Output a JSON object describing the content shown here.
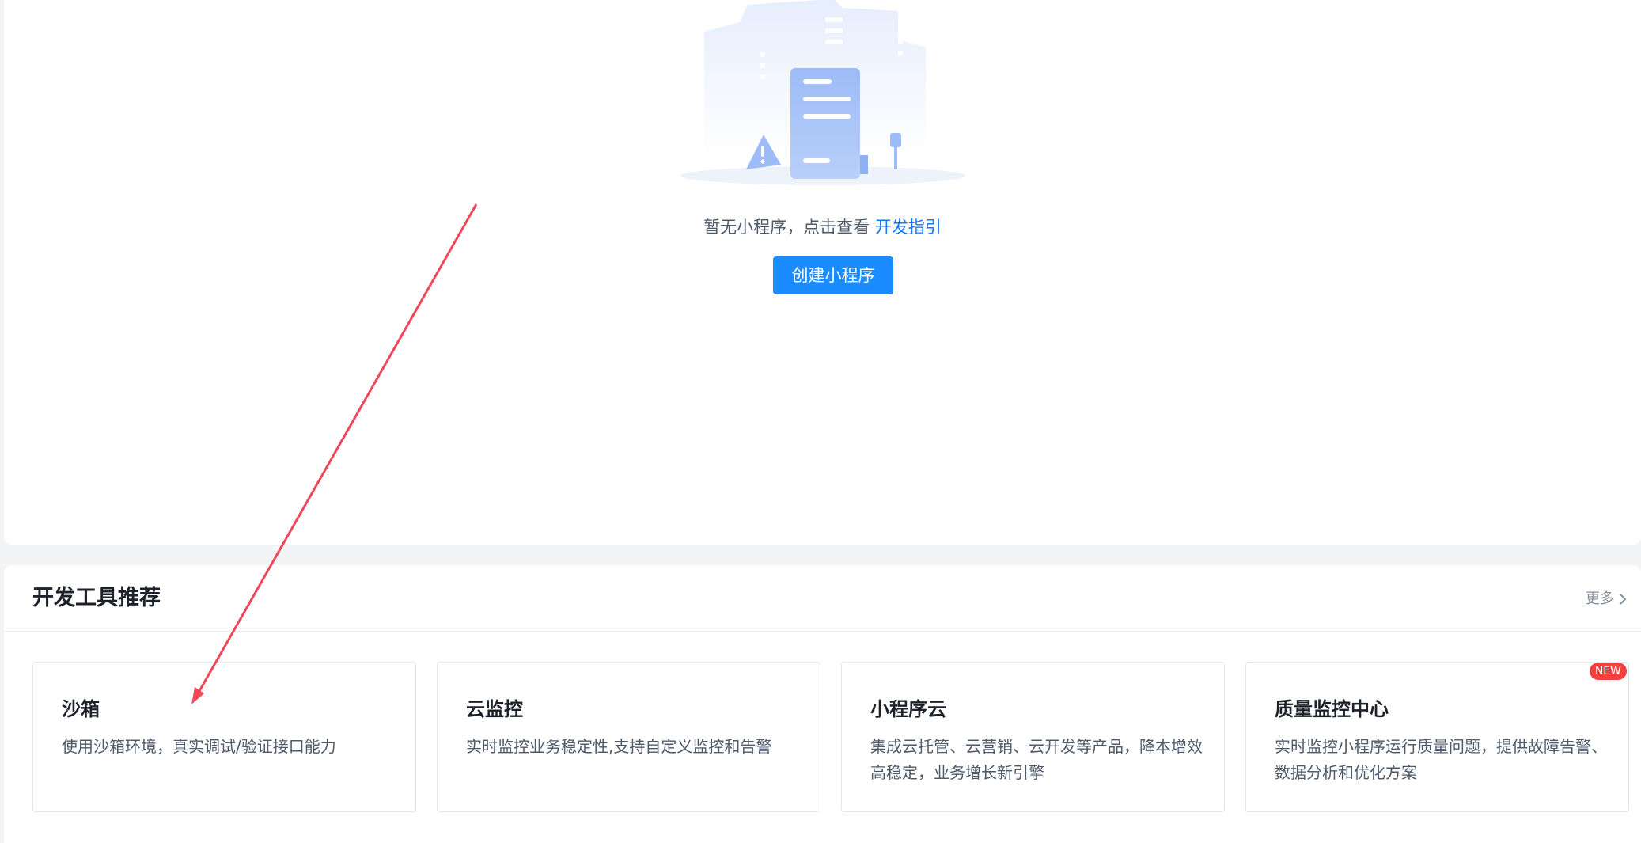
{
  "empty_state": {
    "message": "暂无小程序，点击查看 ",
    "link_label": "开发指引",
    "create_button_label": "创建小程序"
  },
  "tools_section": {
    "title": "开发工具推荐",
    "more_label": "更多",
    "cards": [
      {
        "title": "沙箱",
        "description": "使用沙箱环境，真实调试/验证接口能力"
      },
      {
        "title": "云监控",
        "description": "实时监控业务稳定性,支持自定义监控和告警"
      },
      {
        "title": "小程序云",
        "description": "集成云托管、云营销、云开发等产品，降本增效高稳定，业务增长新引擎"
      },
      {
        "title": "质量监控中心",
        "description": "实时监控小程序运行质量问题，提供故障告警、数据分析和优化方案",
        "badge": "NEW"
      }
    ]
  },
  "colors": {
    "primary": "#1a8cff",
    "link": "#1677ff",
    "badge": "#f53f3f",
    "annotation_arrow": "#f04858"
  },
  "icons": {
    "empty_illustration": "document-warning-illustration",
    "more_chevron": "chevron-right-icon"
  }
}
